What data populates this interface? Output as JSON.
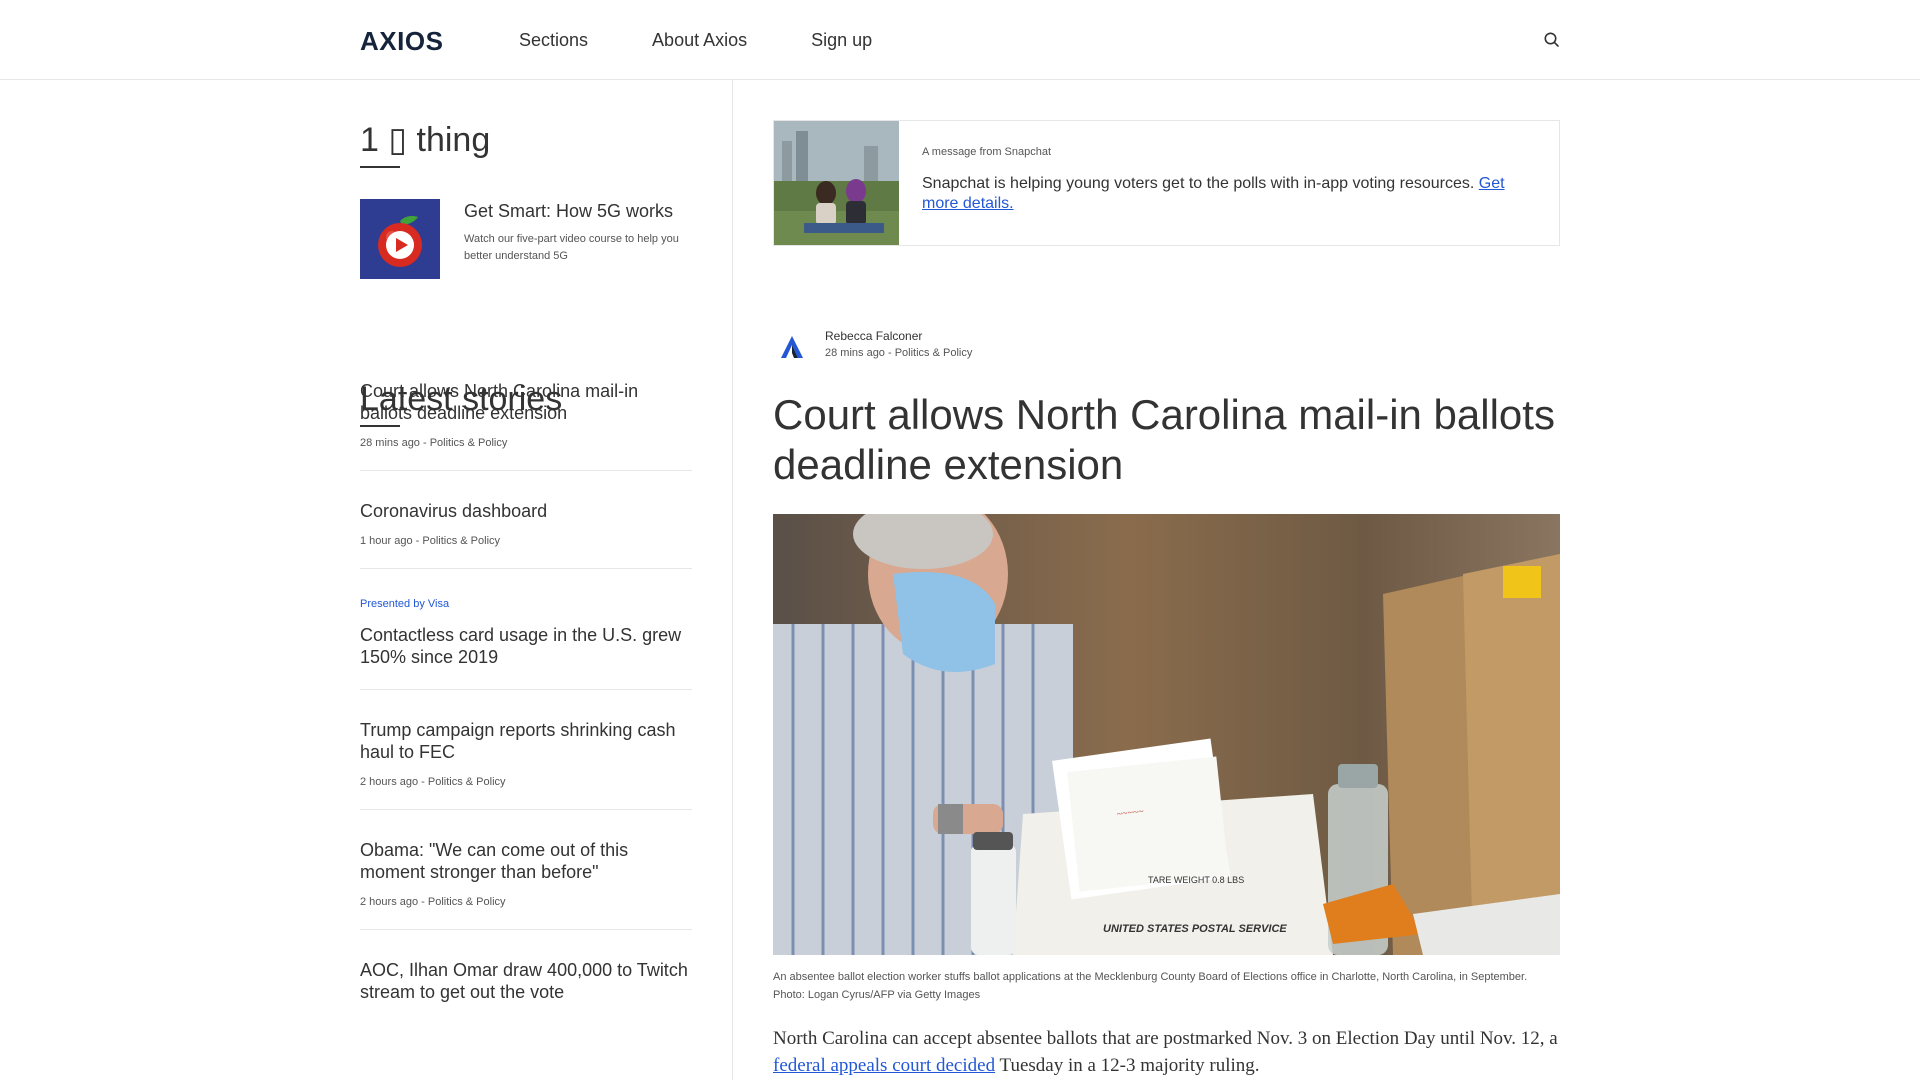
{
  "header": {
    "logo": "AXIOS",
    "nav": [
      "Sections",
      "About Axios",
      "Sign up"
    ],
    "search_icon": "search-icon"
  },
  "sidebar": {
    "one_thing_heading": "1 ▯ thing",
    "promo": {
      "title": "Get Smart: How 5G works",
      "description": "Watch our five-part video course to help you better understand 5G"
    },
    "latest_heading": "Latest stories",
    "stories": [
      {
        "sponsor": "",
        "title": "Court allows North Carolina mail-in ballots deadline extension",
        "meta": "28 mins ago - Politics & Policy"
      },
      {
        "sponsor": "",
        "title": "Coronavirus dashboard",
        "meta": "1 hour ago - Politics & Policy"
      },
      {
        "sponsor": "Presented by Visa",
        "title": "Contactless card usage in the U.S. grew 150% since 2019",
        "meta": ""
      },
      {
        "sponsor": "",
        "title": "Trump campaign reports shrinking cash haul to FEC",
        "meta": "2 hours ago - Politics & Policy"
      },
      {
        "sponsor": "",
        "title": "Obama: \"We can come out of this moment stronger than before\"",
        "meta": "2 hours ago - Politics & Policy"
      },
      {
        "sponsor": "",
        "title": "AOC, Ilhan Omar draw 400,000 to Twitch stream to get out the vote",
        "meta": ""
      }
    ]
  },
  "ad": {
    "label": "A message from Snapchat",
    "text": "Snapchat is helping young voters get to the polls with in-app voting resources.",
    "link": "Get more details."
  },
  "article": {
    "author": "Rebecca Falconer",
    "meta": "28 mins ago - Politics & Policy",
    "headline": "Court allows North Carolina mail-in ballots deadline extension",
    "caption": "An absentee ballot election worker stuffs ballot applications at the Mecklenburg County Board of Elections office in Charlotte, North Carolina, in September. Photo: Logan Cyrus/AFP via Getty Images",
    "body_start": "North Carolina can accept absentee ballots that are postmarked Nov. 3 on Election Day until Nov. 12, a",
    "body_link": "federal appeals court decided",
    "body_end": "Tuesday in a 12-3 majority ruling."
  },
  "image_labels": {
    "bin_weight": "TARE WEIGHT 0.8 LBS",
    "bin_brand": "UNITED STATES POSTAL SERVICE"
  },
  "colors": {
    "accent": "#2257d6",
    "text": "#333333",
    "divider": "#e6e6e6"
  }
}
